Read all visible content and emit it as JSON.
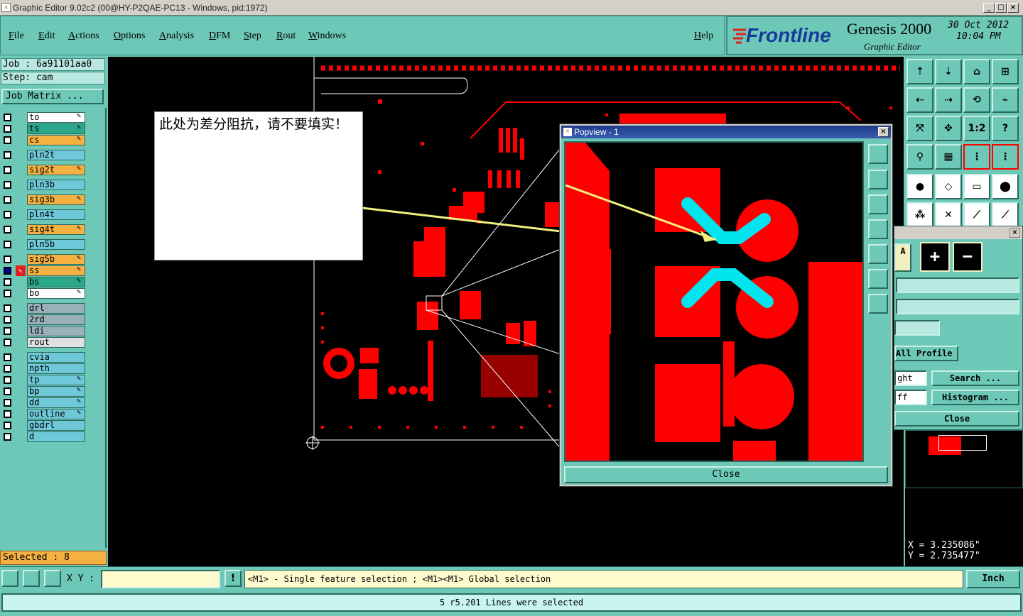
{
  "window": {
    "title": "Graphic Editor 9.02c2 (00@HY-P2QAE-PC13 - Windows, pid:1972)",
    "min": "_",
    "max": "□",
    "close": "×"
  },
  "menu": [
    "File",
    "Edit",
    "Actions",
    "Options",
    "Analysis",
    "DFM",
    "Step",
    "Rout",
    "Windows"
  ],
  "help": "Help",
  "brand": {
    "logo": "Frontline",
    "product": "Genesis 2000",
    "subtitle": "Graphic Editor",
    "date": "30 Oct 2012",
    "time": "10:04 PM"
  },
  "job": {
    "job_line": "Job : 6a91101aa0",
    "step_line": "Step: cam",
    "matrix_button": "Job Matrix ..."
  },
  "layers": [
    {
      "name": "to",
      "color": "#ffffff",
      "pen": true
    },
    {
      "name": "ts",
      "color": "#2aa889",
      "pen": true
    },
    {
      "name": "cs",
      "color": "#f5b042",
      "pen": true
    },
    {
      "name": "pln2t",
      "color": "#6ec8d8",
      "pen": false
    },
    {
      "name": "sig2t",
      "color": "#f5b042",
      "pen": true
    },
    {
      "name": "pln3b",
      "color": "#6ec8d8",
      "pen": false
    },
    {
      "name": "sig3b",
      "color": "#f5b042",
      "pen": true
    },
    {
      "name": "pln4t",
      "color": "#6ec8d8",
      "pen": false
    },
    {
      "name": "sig4t",
      "color": "#f5b042",
      "pen": true
    },
    {
      "name": "pln5b",
      "color": "#6ec8d8",
      "pen": false
    },
    {
      "name": "sig5b",
      "color": "#f5b042",
      "pen": true
    },
    {
      "name": "ss",
      "color": "#f5b042",
      "pen": true,
      "active": true
    },
    {
      "name": "bs",
      "color": "#2aa889",
      "pen": true
    },
    {
      "name": "bo",
      "color": "#ffffff",
      "pen": true
    },
    {
      "name": "drl",
      "color": "#9ab0b8",
      "pen": false
    },
    {
      "name": "2rd",
      "color": "#9ab0b8",
      "pen": false
    },
    {
      "name": "ldi",
      "color": "#9ab0b8",
      "pen": false
    },
    {
      "name": "rout",
      "color": "#e0e0e0",
      "pen": false
    },
    {
      "name": "cvia",
      "color": "#6ec8d8",
      "pen": false
    },
    {
      "name": "npth",
      "color": "#6ec8d8",
      "pen": false
    },
    {
      "name": "tp",
      "color": "#6ec8d8",
      "pen": true
    },
    {
      "name": "bp",
      "color": "#6ec8d8",
      "pen": true
    },
    {
      "name": "dd",
      "color": "#6ec8d8",
      "pen": true
    },
    {
      "name": "outline",
      "color": "#6ec8d8",
      "pen": true
    },
    {
      "name": "gbdrl",
      "color": "#6ec8d8",
      "pen": false
    },
    {
      "name": "d",
      "color": "#6ec8d8",
      "pen": false
    }
  ],
  "selected": "Selected : 8",
  "note": "此处为差分阻抗，请不要填实！",
  "popview": {
    "title": "Popview - 1",
    "close_button": "Close"
  },
  "subpanel": {
    "profile": "All Profile",
    "light_field": "ght",
    "off_field": "ff",
    "search": "Search ...",
    "histogram": "Histogram ...",
    "close": "Close"
  },
  "coords": {
    "x": "X = 3.235086\"",
    "y": "Y = 2.735477\""
  },
  "bottom": {
    "xy_label": "X Y :",
    "message": "<M1> - Single feature selection ; <M1><M1> Global selection",
    "units": "Inch"
  },
  "status": "5 r5.201 Lines were selected",
  "colors": {
    "panel": "#6ec8b8",
    "copper": "#ff0000",
    "highlight": "#00e5ee"
  }
}
